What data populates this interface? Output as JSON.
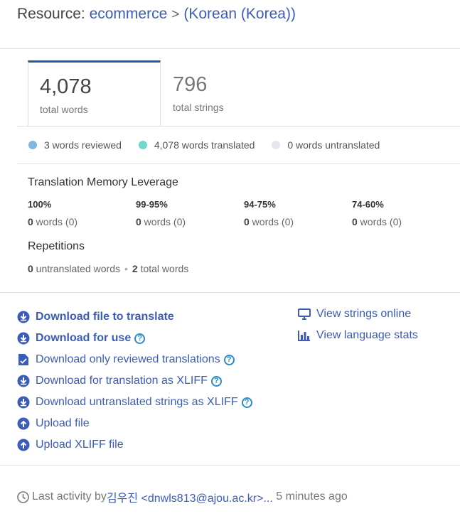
{
  "header": {
    "prefix": "Resource:",
    "resource": "ecommerce",
    "separator": ">",
    "language": "(Korean (Korea))"
  },
  "stats": {
    "words": {
      "value": "4,078",
      "label": "total words"
    },
    "strings": {
      "value": "796",
      "label": "total strings"
    }
  },
  "legend": [
    {
      "text": "3 words reviewed",
      "color": "#7fb9e0"
    },
    {
      "text": "4,078 words translated",
      "color": "#6fd9cd"
    },
    {
      "text": "0 words untranslated",
      "color": "#e6e6ee"
    }
  ],
  "tm": {
    "title": "Translation Memory Leverage",
    "columns": [
      {
        "pct": "100%",
        "count": "0",
        "rest": " words (0)"
      },
      {
        "pct": "99-95%",
        "count": "0",
        "rest": " words (0)"
      },
      {
        "pct": "94-75%",
        "count": "0",
        "rest": " words (0)"
      },
      {
        "pct": "74-60%",
        "count": "0",
        "rest": " words (0)"
      }
    ]
  },
  "repetitions": {
    "title": "Repetitions",
    "untranslated_count": "0",
    "untranslated_label": " untranslated words",
    "separator": "•",
    "total_count": "2",
    "total_label": " total words"
  },
  "actions_left": [
    {
      "label": "Download file to translate",
      "icon": "download-circle-icon",
      "bold": true,
      "help": false
    },
    {
      "label": "Download for use",
      "icon": "download-circle-icon",
      "bold": true,
      "help": true
    },
    {
      "label": "Download only reviewed translations",
      "icon": "file-check-icon",
      "bold": false,
      "help": true
    },
    {
      "label": "Download for translation as XLIFF",
      "icon": "download-circle-icon",
      "bold": false,
      "help": true
    },
    {
      "label": "Download untranslated strings as XLIFF",
      "icon": "download-circle-icon",
      "bold": false,
      "help": true
    },
    {
      "label": "Upload file",
      "icon": "upload-circle-icon",
      "bold": false,
      "help": false
    },
    {
      "label": "Upload XLIFF file",
      "icon": "upload-circle-icon",
      "bold": false,
      "help": false
    }
  ],
  "actions_right": [
    {
      "label": "View strings online",
      "icon": "monitor-icon"
    },
    {
      "label": "View language stats",
      "icon": "bar-chart-icon"
    }
  ],
  "help_glyph": "?",
  "footer": {
    "prefix": "Last activity by ",
    "user": "김우진 <dnwls813@ajou.ac.kr>...",
    "suffix": " 5 minutes ago"
  },
  "colors": {
    "accent": "#3b5cb8",
    "tab_border": "#1f5e9e",
    "help": "#2f8bc6"
  }
}
